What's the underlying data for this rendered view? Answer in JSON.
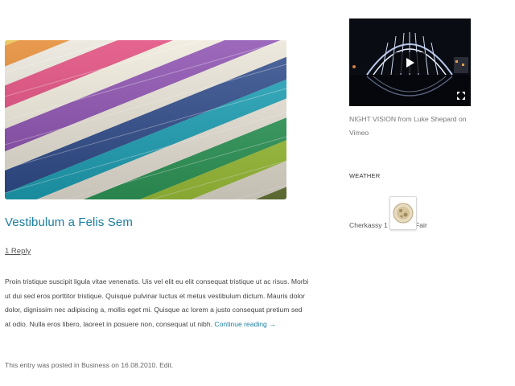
{
  "post": {
    "title": "Vestibulum a Felis Sem",
    "reply_link": "1 Reply",
    "excerpt": "Proin tristique suscipit ligula vitae venenatis. Uis vel elit eu elit consequat tristique ut ac risus. Morbi ut dui sed eros porttitor tristique. Quisque pulvinar luctus et metus vestibulum dictum. Mauris dolor dolor, dignissim nec adipiscing a, mollis eget mi. Quisque ac lorem a justo consequat pretium sed at odio. Nulla eros libero, laoreet in posuere non, consequat ut nibh.",
    "continue_link": "Continue reading →",
    "meta_prefix": "This entry was posted in",
    "meta_category": "Business",
    "meta_on": "on",
    "meta_date": "16.08.2010",
    "meta_edit": "Edit"
  },
  "sidebar": {
    "video": {
      "title_link": "NIGHT VISION",
      "caption_from": "from",
      "author_link": "Luke Shepard",
      "caption_on": "on",
      "site_link": "Vimeo"
    },
    "weather": {
      "title": "WEATHER",
      "city": "Cherkassy 1 C",
      "condition": "Fair"
    }
  },
  "colors": {
    "link": "#1a7fa0",
    "text": "#444444"
  }
}
